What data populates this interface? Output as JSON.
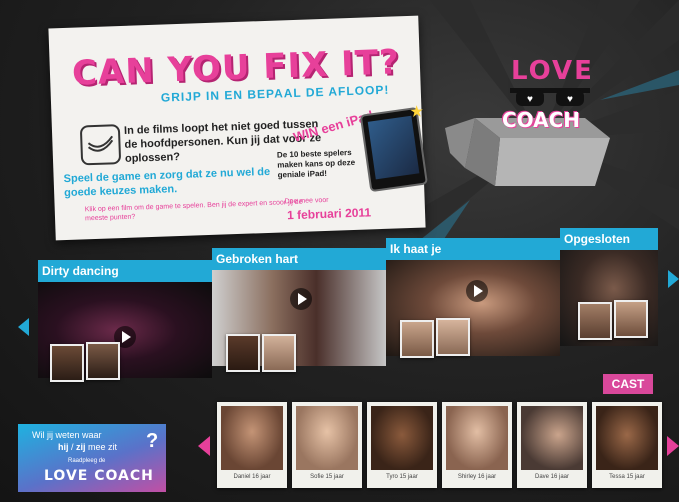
{
  "promo": {
    "title": "CAN YOU FIX IT?",
    "subtitle": "GRIJP IN EN BEPAAL DE AFLOOP!",
    "intro": "In de films loopt het niet goed tussen de hoofdpersonen. Kun jij dat voor ze oplossen?",
    "cta": "Speel de game en zorg dat ze nu wel de goede keuzes maken.",
    "hint": "Klik op een film om de game te spelen. Ben jij de expert en scoor jij de meeste punten?",
    "win": "WIN een iPad",
    "prize_text": "De 10 beste spelers maken kans op deze geniale iPad!",
    "deadline_label": "Doe mee voor",
    "deadline": "1 februari 2011",
    "accent": "#e7409a",
    "blue": "#22a9d6"
  },
  "logo": {
    "line1": "LOVE",
    "line2": "COACH"
  },
  "videos": [
    {
      "title": "Dirty dancing"
    },
    {
      "title": "Gebroken hart"
    },
    {
      "title": "Ik haat je"
    },
    {
      "title": "Opgesloten"
    }
  ],
  "cast": {
    "button": "CAST",
    "members": [
      {
        "label": "Daniel 16 jaar"
      },
      {
        "label": "Sofie 15 jaar"
      },
      {
        "label": "Tyro 15 jaar"
      },
      {
        "label": "Shirley 16 jaar"
      },
      {
        "label": "Dave 16 jaar"
      },
      {
        "label": "Tessa 15 jaar"
      }
    ]
  },
  "coach_panel": {
    "line1": "Wil jij weten waar",
    "hij": "hij",
    "sep": " / ",
    "zij": "zij",
    "line2_rest": " mee zit",
    "question": "?",
    "line3": "Raadpleeg de",
    "line4": "LOVE COACH"
  }
}
